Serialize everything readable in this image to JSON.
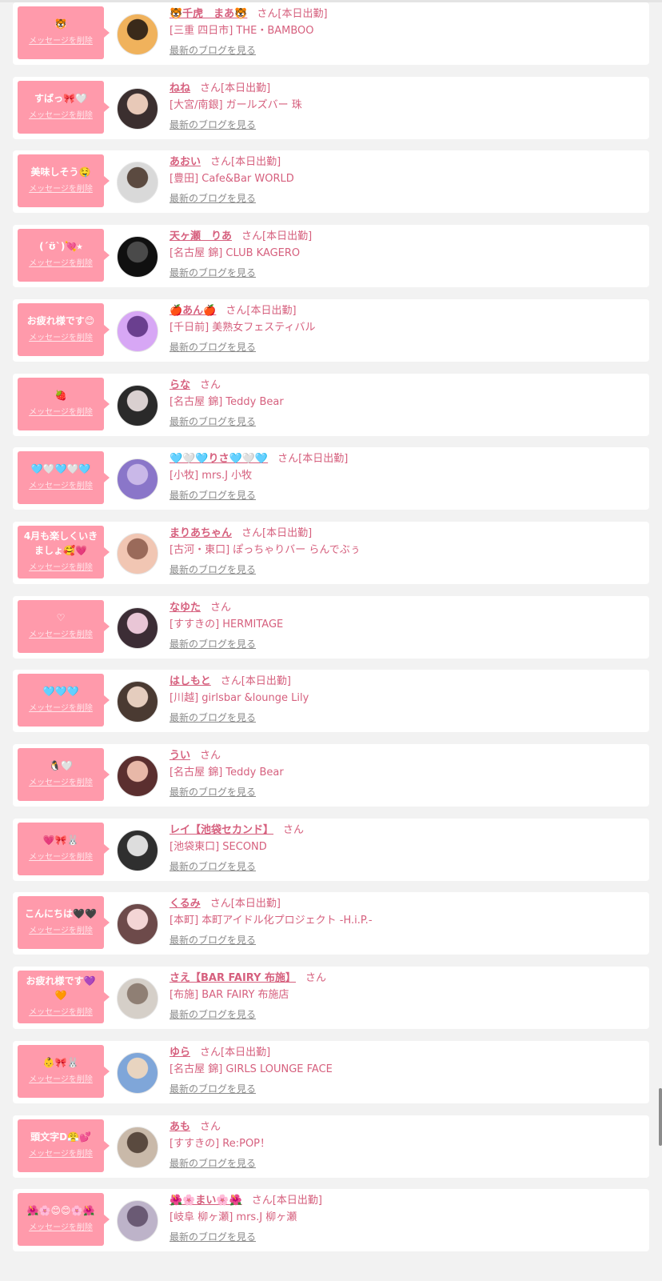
{
  "labels": {
    "delete": "メッセージを削除",
    "blog": "最新のブログを見る",
    "san": "さん",
    "today": "[本日出勤]"
  },
  "colors": {
    "accent": "#ff9aab",
    "name": "#d6607e",
    "link": "#8a8a8a"
  },
  "items": [
    {
      "msg": "🐯",
      "name": "🐯千虎　まあ🐯",
      "today": true,
      "shop": "[三重 四日市] THE・BAMBOO"
    },
    {
      "msg": "すばっ🎀🤍",
      "name": "ねね",
      "today": true,
      "shop": "[大宮/南銀] ガールズバー 珠"
    },
    {
      "msg": "美味しそう🤤",
      "name": "あおい",
      "today": true,
      "shop": "[豊田] Cafe&Bar WORLD"
    },
    {
      "msg": "(´ʊ̈`)💘⭑",
      "name": "天ヶ瀬　りあ",
      "today": true,
      "shop": "[名古屋 錦] CLUB KAGERO"
    },
    {
      "msg": "お疲れ様です😊",
      "name": "🍎あん🍎",
      "today": true,
      "shop": "[千日前] 美熟女フェスティバル"
    },
    {
      "msg": "🍓",
      "name": "らな",
      "today": false,
      "shop": "[名古屋 錦] Teddy Bear"
    },
    {
      "msg": "🩵🤍🩵🤍🩵",
      "name": "🩵🤍🩵りさ🩵🤍🩵",
      "today": true,
      "shop": "[小牧] mrs.J 小牧"
    },
    {
      "msg": "4月も楽しくいきましょ🥰💗",
      "name": "まりあちゃん",
      "today": true,
      "shop": "[古河・東口] ぽっちゃりバー らんでぶぅ"
    },
    {
      "msg": "♡",
      "name": "なゆた",
      "today": false,
      "shop": "[すすきの] HERMITAGE"
    },
    {
      "msg": "🩵🩵🩵",
      "name": "はしもと",
      "today": true,
      "shop": "[川越] girlsbar &lounge Lily"
    },
    {
      "msg": "🐧🤍",
      "name": "うい",
      "today": false,
      "shop": "[名古屋 錦] Teddy Bear"
    },
    {
      "msg": "💗🎀🐰",
      "name": "レイ【池袋セカンド】",
      "today": false,
      "shop": "[池袋東口] SECOND"
    },
    {
      "msg": "こんにちは🖤🖤",
      "name": "くるみ",
      "today": true,
      "shop": "[本町] 本町アイドル化プロジェクト -H.i.P.-"
    },
    {
      "msg": "お疲れ様です💜🧡",
      "name": "さえ【BAR FAIRY 布施】",
      "today": false,
      "shop": "[布施] BAR FAIRY 布施店"
    },
    {
      "msg": "👶🎀🐰",
      "name": "ゆら",
      "today": true,
      "shop": "[名古屋 錦] GIRLS LOUNGE FACE"
    },
    {
      "msg": "頭文字D😤💕",
      "name": "あも",
      "today": false,
      "shop": "[すすきの] Re:POP！"
    },
    {
      "msg": "🌺🌸😊😊🌸🌺",
      "name": "🌺🌸まい🌸🌺",
      "today": true,
      "shop": "[岐阜 柳ヶ瀬] mrs.J 柳ヶ瀬"
    }
  ]
}
